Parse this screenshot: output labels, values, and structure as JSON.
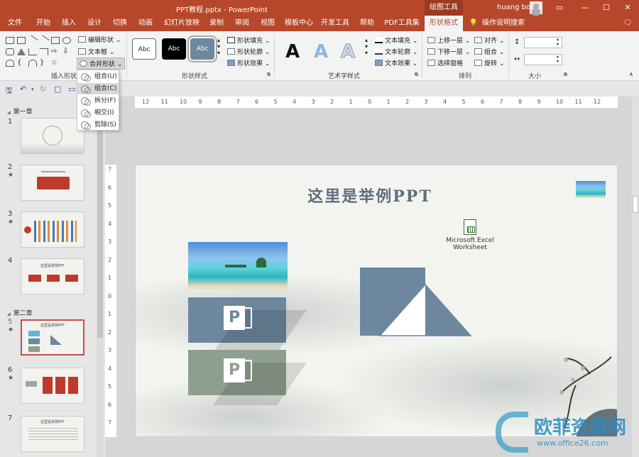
{
  "window": {
    "title": "PPT教程.pptx  -  PowerPoint",
    "context_tool": "绘图工具",
    "user": "huang bo",
    "controls": [
      "▭",
      "—",
      "☐",
      "✕"
    ]
  },
  "tabs": [
    "文件",
    "开始",
    "插入",
    "设计",
    "切换",
    "动画",
    "幻灯片放映",
    "录制",
    "审阅",
    "视图",
    "模板中心",
    "开发工具",
    "帮助",
    "PDF工具集",
    "形状格式",
    "操作说明搜索"
  ],
  "active_tab": "形状格式",
  "ribbon": {
    "insert_shapes": {
      "label": "插入形状",
      "edit_shape": "编辑形状",
      "text_box": "文本框",
      "merge_shapes": "合并形状"
    },
    "shape_styles": {
      "label": "形状样式",
      "swatches": [
        "Abc",
        "Abc",
        "Abc"
      ],
      "fill": "形状填充",
      "outline": "形状轮廓",
      "effects": "形状效果"
    },
    "wordart": {
      "label": "艺术字样式",
      "letters": [
        "A",
        "A",
        "A"
      ],
      "text_fill": "文本填充",
      "text_outline": "文本轮廓",
      "text_effects": "文本效果"
    },
    "arrange": {
      "label": "排列",
      "bring_forward": "上移一层",
      "send_backward": "下移一层",
      "selection_pane": "选择窗格",
      "align": "对齐",
      "group": "组合",
      "rotate": "旋转"
    },
    "size": {
      "label": "大小",
      "height_value": "",
      "width_value": ""
    }
  },
  "merge_menu": {
    "items": [
      "组合(U)",
      "组合(C)",
      "拆分(F)",
      "相交(I)",
      "剪除(S)"
    ],
    "highlighted_index": 1
  },
  "slides_panel": {
    "sections": [
      "第一章",
      "第二章"
    ],
    "slides": [
      {
        "num": "1",
        "star": "",
        "thumb_text": ""
      },
      {
        "num": "2",
        "star": "★",
        "thumb_text": ""
      },
      {
        "num": "3",
        "star": "★",
        "thumb_text": ""
      },
      {
        "num": "4",
        "star": "",
        "thumb_text": "这里是举例PPT"
      },
      {
        "num": "5",
        "star": "★",
        "thumb_text": "这里是举例PPT"
      },
      {
        "num": "6",
        "star": "★",
        "thumb_text": ""
      },
      {
        "num": "7",
        "star": "",
        "thumb_text": "这里是举例PPT"
      }
    ],
    "selected": "5"
  },
  "ruler": {
    "h_labels": [
      "12",
      "11",
      "10",
      "9",
      "8",
      "7",
      "6",
      "5",
      "4",
      "3",
      "2",
      "1",
      "0",
      "1",
      "2",
      "3",
      "4",
      "5",
      "6",
      "7",
      "8",
      "9",
      "10",
      "11",
      "12"
    ],
    "v_labels": [
      "7",
      "6",
      "5",
      "4",
      "3",
      "2",
      "1",
      "0",
      "1",
      "2",
      "3",
      "4",
      "5",
      "6",
      "7"
    ]
  },
  "slide": {
    "title": "这里是举例PPT",
    "embedded_object": "Microsoft Excel Worksheet",
    "ppt_letter": "P",
    "colors": {
      "accent_blue": "#6d879e",
      "accent_green": "#8f9f8e",
      "title_color": "#5e6e7e",
      "ribbon_red": "#b7472a"
    }
  },
  "watermark": {
    "brand": "欧菲资源网",
    "url": "www.office26.com"
  }
}
